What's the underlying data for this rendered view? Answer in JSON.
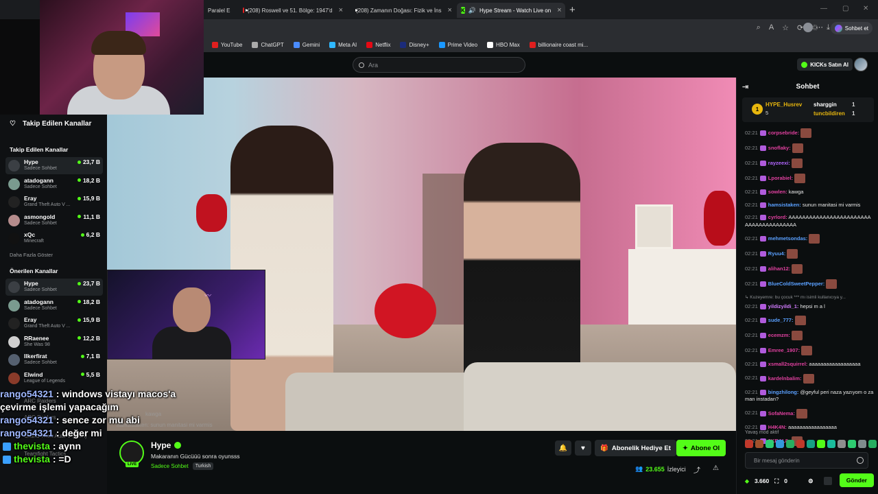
{
  "browser": {
    "tabs": [
      {
        "label": "Paralel E",
        "icon": "none",
        "active": false
      },
      {
        "label": "(208) Roswell ve 51. Bölge: 1947'd",
        "icon": "youtube-icon",
        "active": false
      },
      {
        "label": "(208) Zamanın Doğası: Fizik ve İns",
        "icon": "youtube-icon",
        "active": false
      },
      {
        "label": "Hype Stream - Watch Live on",
        "icon": "kick-icon",
        "active": true
      }
    ],
    "new_tab": "+",
    "copilot_label": "Sohbet et",
    "bookmarks": [
      {
        "label": "YouTube",
        "color": "#e01f1f"
      },
      {
        "label": "ChatGPT",
        "color": "#aaaaaa"
      },
      {
        "label": "Gemini",
        "color": "#4a8cff"
      },
      {
        "label": "Meta AI",
        "color": "#2fb8ff"
      },
      {
        "label": "Netflix",
        "color": "#e50914"
      },
      {
        "label": "Disney+",
        "color": "#1b2b7a"
      },
      {
        "label": "Prime Video",
        "color": "#1a98ff"
      },
      {
        "label": "HBO Max",
        "color": "#ffffff"
      },
      {
        "label": "billionaire coast mi...",
        "color": "#e01f1f"
      }
    ]
  },
  "kick": {
    "search_placeholder": "Ara",
    "kicks_button": "KICKs Satın Al",
    "accent": "#53fc18"
  },
  "sidebar": {
    "followed_header": "Takip Edilen Kanallar",
    "followed_section": "Takip Edilen Kanallar",
    "followed": [
      {
        "name": "Hype",
        "sub": "Sadece Sohbet",
        "viewers": "23,7 B",
        "color": "#3b3f44",
        "highlight": true
      },
      {
        "name": "atadogann",
        "sub": "Sadece Sohbet",
        "viewers": "18,2 B",
        "color": "#7a9b8f",
        "highlight": false
      },
      {
        "name": "Eray",
        "sub": "Grand Theft Auto V ...",
        "viewers": "15,9 B",
        "color": "#222222",
        "highlight": false
      },
      {
        "name": "asmongold",
        "sub": "Sadece Sohbet",
        "viewers": "11,1 B",
        "color": "#b58c8c",
        "highlight": false
      },
      {
        "name": "xQc",
        "sub": "Minecraft",
        "viewers": "6,2 B",
        "color": "#111111",
        "highlight": false
      }
    ],
    "show_more": "Daha Fazla Göster",
    "recommended_section": "Önerilen Kanallar",
    "recommended": [
      {
        "name": "Hype",
        "sub": "Sadece Sohbet",
        "viewers": "23,7 B",
        "color": "#3b3f44",
        "highlight": true
      },
      {
        "name": "atadogann",
        "sub": "Sadece Sohbet",
        "viewers": "18,2 B",
        "color": "#7a9b8f",
        "highlight": false
      },
      {
        "name": "Eray",
        "sub": "Grand Theft Auto V ...",
        "viewers": "15,9 B",
        "color": "#222222",
        "highlight": false
      },
      {
        "name": "RRaenee",
        "sub": "She Was 98",
        "viewers": "12,2 B",
        "color": "#cfcfcf",
        "highlight": false
      },
      {
        "name": "Ilkerfirat",
        "sub": "Sadece Sohbet",
        "viewers": "7,1 B",
        "color": "#556070",
        "highlight": false
      },
      {
        "name": "Elwind",
        "sub": "League of Legends",
        "viewers": "5,5 B",
        "color": "#8a3b2a",
        "highlight": false
      }
    ]
  },
  "overlay_chat": [
    {
      "user": "rango54321",
      "text": ": windows vistayı macos'a",
      "style": "u1",
      "icon": false
    },
    {
      "user": "",
      "text": "çevirme işlemi yapacağım",
      "style": "u1",
      "icon": false
    },
    {
      "user": "rango54321",
      "text": ": sence zor mu abi",
      "style": "u1",
      "icon": false
    },
    {
      "user": "rango54321",
      "text": ": değer mi",
      "style": "u1",
      "icon": false
    },
    {
      "user": "thevista",
      "text": ": aynn",
      "style": "u2",
      "icon": true
    },
    {
      "user": "thevista",
      "text": ": =D",
      "style": "u2",
      "icon": true
    }
  ],
  "overlay_ghost": {
    "arc1": "ARC Raiders",
    "arc2": "ARC Raiders",
    "gta": "Grand Theft Auto V (GTA)",
    "tft": "Teamfight Tactics",
    "kawga": "kawga",
    "manita": "hamsistaken: sunun manitasi mi varmis"
  },
  "stream": {
    "channel": "Hype",
    "live_badge": "LIVE",
    "title": "Makaranın Gücüüü sonra oyunsss",
    "category": "Sadece Sohbet",
    "tag": "Turkish",
    "gift_button": "Abonelik Hediye Et",
    "subscribe_button": "Abone Ol",
    "viewers_count": "23.655",
    "viewers_label": "İzleyici"
  },
  "chat": {
    "title": "Sohbet",
    "pinned": {
      "rank": "1",
      "top_user": "HYPE_Husrev",
      "top_count": "5",
      "second_user": "sharggin",
      "second_count": "1",
      "third_user": "tuncbildiren",
      "third_count": "1"
    },
    "messages": [
      {
        "time": "02:21",
        "user": "corpsebride:",
        "color": "#e0409f",
        "text": "",
        "emote": true
      },
      {
        "time": "02:21",
        "user": "snoflaky:",
        "color": "#e0409f",
        "text": "",
        "emote": true
      },
      {
        "time": "02:21",
        "user": "rayzeexi:",
        "color": "#b266ff",
        "text": "",
        "emote": true
      },
      {
        "time": "02:21",
        "user": "Lporabiel:",
        "color": "#e0409f",
        "text": "",
        "emote": true
      },
      {
        "time": "02:21",
        "user": "sowlen:",
        "color": "#e0409f",
        "text": "kawga",
        "emote": false
      },
      {
        "time": "02:21",
        "user": "hamsistaken:",
        "color": "#5aa0ff",
        "text": "sunun manitasi mi varmis",
        "emote": false
      },
      {
        "time": "02:21",
        "user": "cyrlord:",
        "color": "#e0409f",
        "text": "AAAAAAAAAAAAAAAAAAAAAAAAAAAAAAAAAAAAAAA",
        "emote": false
      },
      {
        "time": "02:21",
        "user": "mehmetsondas:",
        "color": "#5aa0ff",
        "text": "",
        "emote": true
      },
      {
        "time": "02:21",
        "user": "Ryuu4:",
        "color": "#5aa0ff",
        "text": "",
        "emote": true
      },
      {
        "time": "02:21",
        "user": "alihan12:",
        "color": "#e0409f",
        "text": "",
        "emote": true
      },
      {
        "time": "02:21",
        "user": "BlueColdSweetPepper:",
        "color": "#5aa0ff",
        "text": "",
        "emote": true
      },
      {
        "time": "",
        "user": "",
        "color": "#8a8d90",
        "text": "↳ Kuzeyemre: bu çocuk *** mı isimli kullanıcıya y...",
        "emote": false
      },
      {
        "time": "02:21",
        "user": "yildizyildi_1:",
        "color": "#d27cff",
        "text": "hepsi m a l",
        "emote": false
      },
      {
        "time": "02:21",
        "user": "sude_777:",
        "color": "#5aa0ff",
        "text": "",
        "emote": true
      },
      {
        "time": "02:21",
        "user": "ecemzm:",
        "color": "#e0409f",
        "text": "",
        "emote": true
      },
      {
        "time": "02:21",
        "user": "Emree_1907:",
        "color": "#e0409f",
        "text": "",
        "emote": true
      },
      {
        "time": "02:21",
        "user": "xsmall2squirrel:",
        "color": "#e0409f",
        "text": "aaaaaaaaaaaaaaaaaa",
        "emote": false
      },
      {
        "time": "02:21",
        "user": "kardelnbalim:",
        "color": "#e0409f",
        "text": "",
        "emote": true
      },
      {
        "time": "02:21",
        "user": "bingzhilong:",
        "color": "#5aa0ff",
        "text": "@geyful peri naza yazıyom o zaman instadan?",
        "emote": false
      },
      {
        "time": "02:21",
        "user": "SofaNema:",
        "color": "#e0409f",
        "text": "",
        "emote": true
      },
      {
        "time": "02:21",
        "user": "H4K4N:",
        "color": "#e0409f",
        "text": "aaaaaaaaaaaaaaaaa",
        "emote": false
      },
      {
        "time": "02:21",
        "user": "8KRAL8:",
        "color": "#e0409f",
        "text": "",
        "emote": true
      }
    ],
    "slow_mode": "Yavaş mod aktif",
    "input_placeholder": "Bir mesaj gönderin",
    "points": "3.660",
    "drops": "0",
    "send_button": "Gönder"
  }
}
